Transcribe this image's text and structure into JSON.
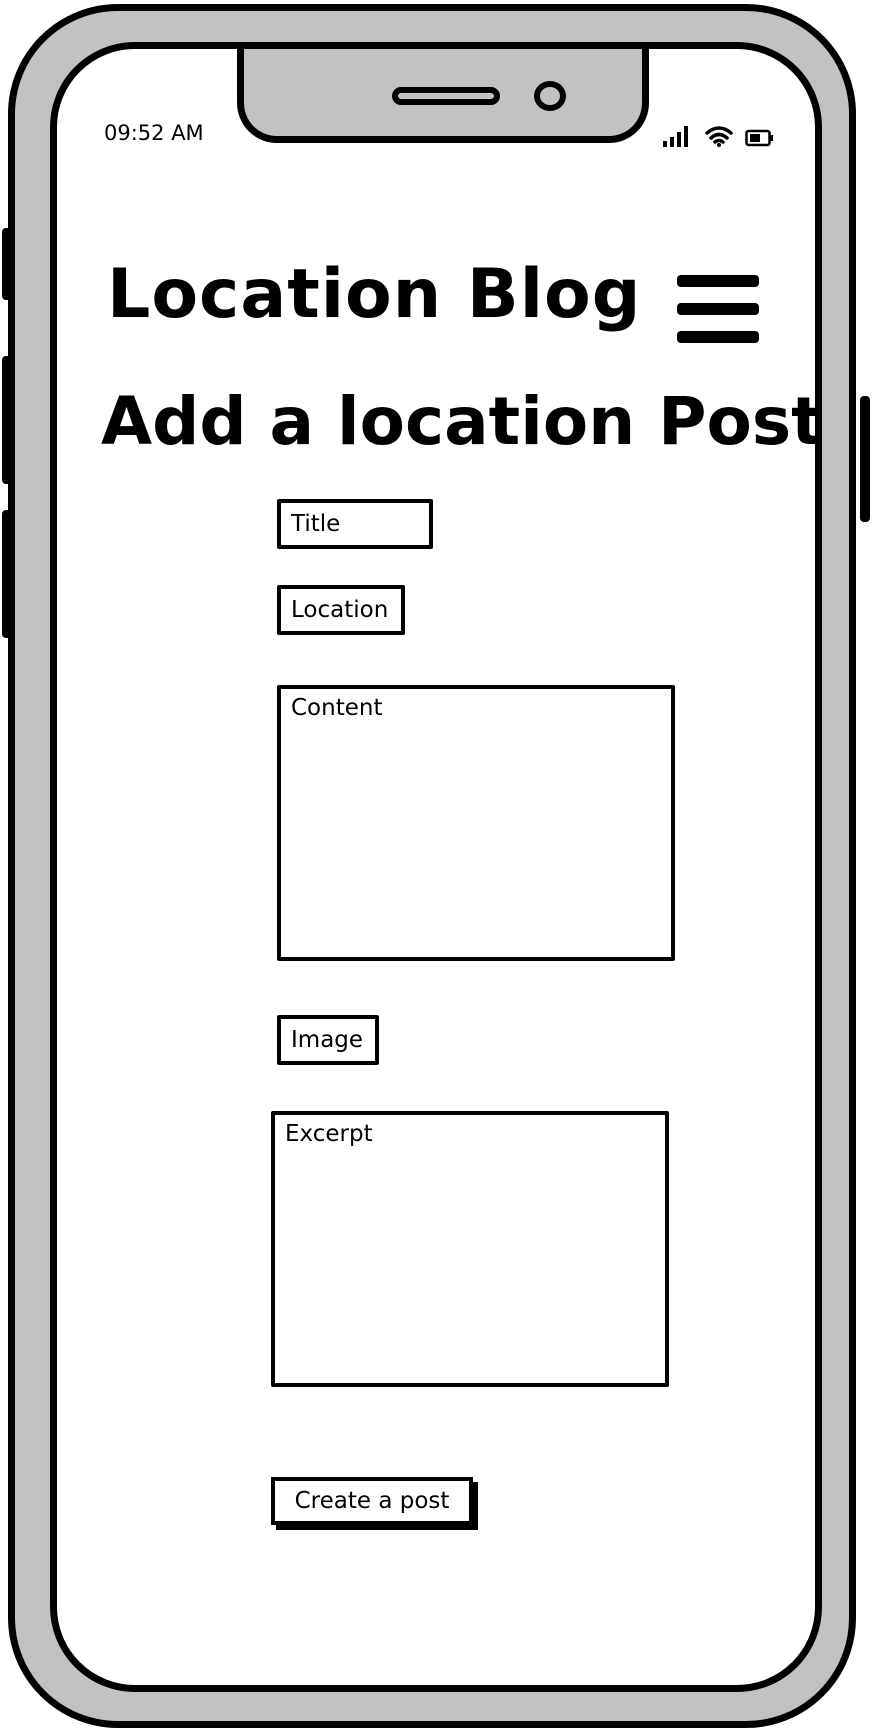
{
  "status_bar": {
    "time": "09:52 AM",
    "icons": [
      "signal-icon",
      "wifi-icon",
      "battery-icon"
    ]
  },
  "header": {
    "app_title": "Location Blog",
    "menu_icon": "hamburger-menu-icon"
  },
  "page": {
    "title": "Add a location Post"
  },
  "form": {
    "title_placeholder": "Title",
    "location_placeholder": "Location",
    "content_placeholder": "Content",
    "image_label": "Image",
    "excerpt_placeholder": "Excerpt",
    "submit_label": "Create a post"
  }
}
